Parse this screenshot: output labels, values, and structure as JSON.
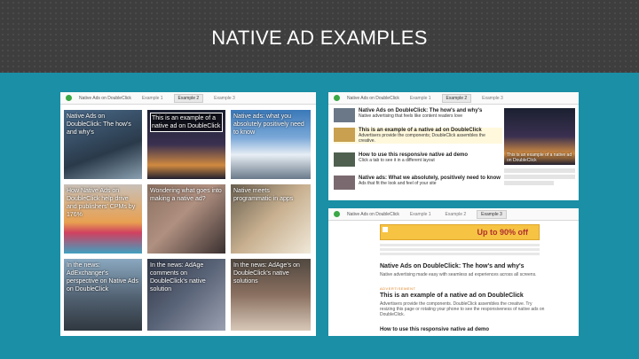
{
  "title": "NATIVE AD EXAMPLES",
  "left_panel": {
    "app_title": "Native Ads on DoubleClick",
    "tabs": [
      "Example 1",
      "Example 2",
      "Example 3"
    ],
    "tiles": [
      "Native Ads on DoubleClick: The how's and why's",
      "This is an example of a native ad on DoubleClick",
      "Native ads: what you absolutely positively need to know",
      "How Native Ads on DoubleClick help drive and publishers' CPMs by 176%",
      "Wondering what goes into making a native ad?",
      "Native meets programmatic in apps",
      "In the news: AdExchanger's perspective on Native Ads on DoubleClick",
      "In the news: AdAge comments on DoubleClick's native solution",
      "In the news: AdAge's on DoubleClick's native solutions"
    ]
  },
  "top_right_panel": {
    "app_title": "Native Ads on DoubleClick",
    "tabs": [
      "Example 1",
      "Example 2",
      "Example 3"
    ],
    "rows": [
      {
        "title": "Native Ads on DoubleClick: The how's and why's",
        "sub": "Native advertising that feels like content readers love"
      },
      {
        "title": "This is an example of a native ad on DoubleClick",
        "sub": "Advertisers provide the components; DoubleClick assembles the creative."
      },
      {
        "title": "How to use this responsive native ad demo",
        "sub": "Click a tab to see it in a different layout"
      },
      {
        "title": "Native ads: What we absolutely, positively need to know",
        "sub": "Ads that fit the look and feel of your site"
      }
    ],
    "feature_caption": "This is an example of a native ad on DoubleClick"
  },
  "bottom_right_panel": {
    "app_title": "Native Ads on DoubleClick",
    "tabs": [
      "Example 1",
      "Example 2",
      "Example 3"
    ],
    "ad_text": "Up to 90% off",
    "heading1": "Native Ads on DoubleClick: The how's and why's",
    "body1": "Native advertising made easy with seamless ad experiences across all screens.",
    "label": "ADVERTISEMENT",
    "heading2": "This is an example of a native ad on DoubleClick",
    "body2": "Advertisers provide the components. DoubleClick assembles the creative. Try resizing this page or rotating your phone to see the responsiveness of native ads on DoubleClick.",
    "heading3": "How to use this responsive native ad demo"
  },
  "colors": {
    "background": "#1a8fa5",
    "header": "#3e3e3e",
    "accent": "#3aa845"
  }
}
